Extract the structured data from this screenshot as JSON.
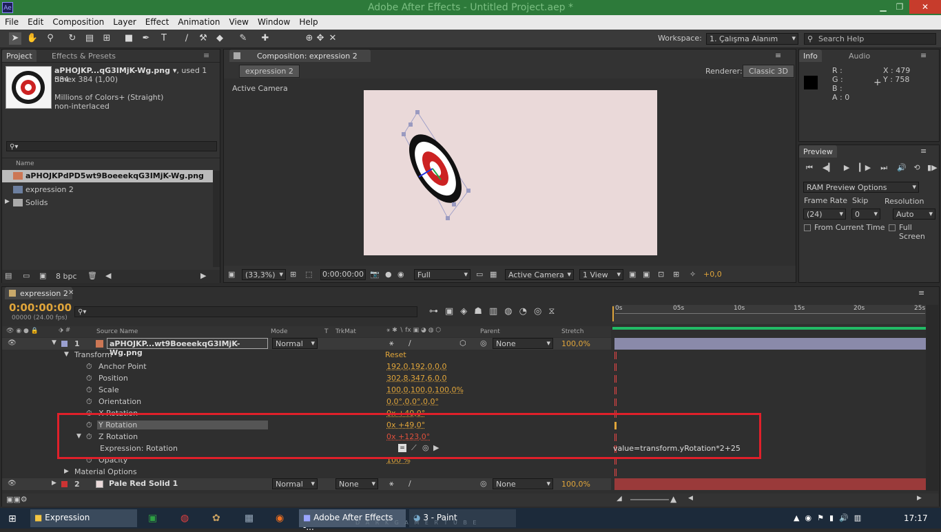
{
  "app": {
    "title": "Adobe After Effects - Untitled Project.aep *",
    "icon_label": "Ae"
  },
  "menu": [
    "File",
    "Edit",
    "Composition",
    "Layer",
    "Effect",
    "Animation",
    "View",
    "Window",
    "Help"
  ],
  "toolbar": {
    "workspace_label": "Workspace:",
    "workspace_value": "1. Çalışma Alanım",
    "search_placeholder": "Search Help"
  },
  "project": {
    "tabs": [
      "Project",
      "Effects & Presets"
    ],
    "asset_name": "aPHOJKP...qG3IMjK-Wg.png ▾",
    "asset_used": ", used 1 time",
    "asset_dims": "384 x 384 (1,00)",
    "asset_colors": "Millions of Colors+ (Straight)",
    "asset_interlace": "non-interlaced",
    "name_header": "Name",
    "items": [
      "aPHOJKPdPD5wt9BoeeekqG3IMjK-Wg.png",
      "expression 2",
      "Solids"
    ],
    "bpc": "8 bpc"
  },
  "comp": {
    "tab": "Composition: expression 2",
    "subtab": "expression 2",
    "renderer_label": "Renderer:",
    "renderer_value": "Classic 3D",
    "camera_label": "Active Camera",
    "zoom": "(33,3%)",
    "time": "0:00:00:00",
    "quality": "Full",
    "view": "Active Camera",
    "views": "1 View",
    "exposure": "+0,0",
    "bg_color": "#ead9d9"
  },
  "info": {
    "tabs": [
      "Info",
      "Audio"
    ],
    "r": "R :",
    "g": "G :",
    "b": "B :",
    "a": "A : 0",
    "x": "X : 479",
    "y": "Y : 758"
  },
  "preview": {
    "tab": "Preview",
    "ram": "RAM Preview Options",
    "framerate_label": "Frame Rate",
    "skip_label": "Skip",
    "resolution_label": "Resolution",
    "framerate": "(24)",
    "skip": "0",
    "resolution": "Auto",
    "from_current": "From Current Time",
    "full_screen": "Full Screen"
  },
  "timeline": {
    "tab": "expression 2",
    "timecode": "0:00:00:00",
    "fps": "00000 (24.00 fps)",
    "headers": {
      "source": "Source Name",
      "mode": "Mode",
      "t": "T",
      "trkmat": "TrkMat",
      "parent": "Parent",
      "stretch": "Stretch"
    },
    "ruler": [
      "0s",
      "05s",
      "10s",
      "15s",
      "20s",
      "25s"
    ],
    "layer1": {
      "num": "1",
      "name": "aPHOJKP...wt9BoeeekqG3IMjK-Wg.png",
      "mode": "Normal",
      "parent": "None",
      "stretch": "100,0%"
    },
    "transform": {
      "label": "Transform",
      "reset": "Reset"
    },
    "props": [
      {
        "name": "Anchor Point",
        "value": "192,0,192,0,0,0"
      },
      {
        "name": "Position",
        "value": "302,8,347,6,0,0"
      },
      {
        "name": "Scale",
        "value": "100,0,100,0,100,0%"
      },
      {
        "name": "Orientation",
        "value": "0,0°,0,0°,0,0°"
      },
      {
        "name": "X Rotation",
        "value": "0x +40,0°"
      },
      {
        "name": "Y Rotation",
        "value": "0x +49,0°"
      },
      {
        "name": "Z Rotation",
        "value": "0x +123,0°"
      },
      {
        "name": "Expression: Rotation",
        "value": ""
      },
      {
        "name": "Opacity",
        "value": "100 %"
      }
    ],
    "expression": "value=transform.yRotation*2+25",
    "material": "Material Options",
    "layer2": {
      "num": "2",
      "name": "Pale Red Solid 1",
      "mode": "Normal",
      "trkmat": "None",
      "parent": "None",
      "stretch": "100,0%"
    }
  },
  "taskbar": {
    "items": [
      "Expression",
      "Adobe After Effects -...",
      "3 - Paint"
    ],
    "clock": "17:17",
    "watermark": "D A R K G A M E R  T U B E"
  }
}
